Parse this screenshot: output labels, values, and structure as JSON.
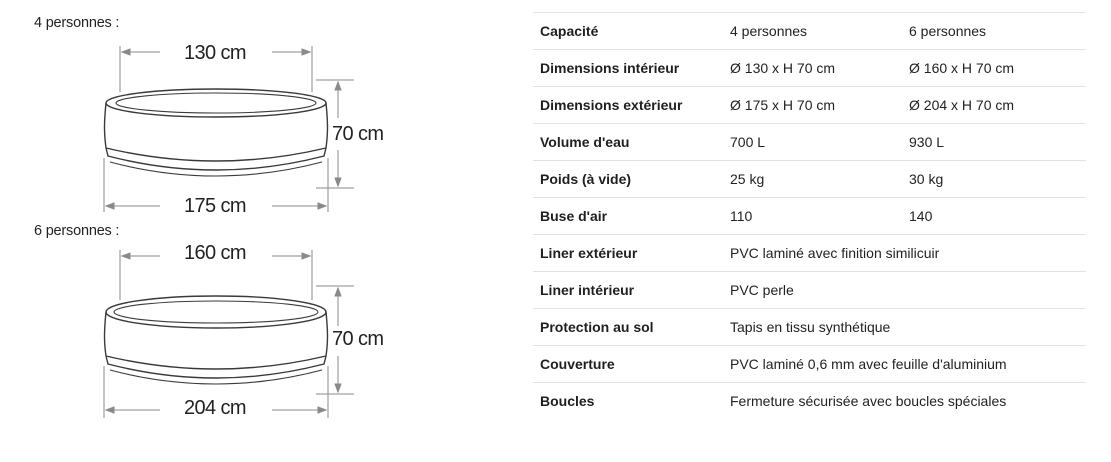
{
  "diagrams": [
    {
      "caption": "4 personnes :",
      "top_dim": "130 cm",
      "height_dim": "70 cm",
      "bottom_dim": "175 cm"
    },
    {
      "caption": "6 personnes :",
      "top_dim": "160 cm",
      "height_dim": "70 cm",
      "bottom_dim": "204 cm"
    }
  ],
  "specs": [
    {
      "label": "Capacité",
      "v1": "4 personnes",
      "v2": "6 personnes"
    },
    {
      "label": "Dimensions intérieur",
      "v1": "Ø 130 x H 70 cm",
      "v2": "Ø 160 x H 70 cm"
    },
    {
      "label": "Dimensions extérieur",
      "v1": "Ø 175 x H 70 cm",
      "v2": "Ø 204 x H 70 cm"
    },
    {
      "label": "Volume d'eau",
      "v1": "700 L",
      "v2": "930 L"
    },
    {
      "label": "Poids (à vide)",
      "v1": "25 kg",
      "v2": "30 kg"
    },
    {
      "label": "Buse d'air",
      "v1": "110",
      "v2": "140"
    },
    {
      "label": "Liner extérieur",
      "span": "PVC laminé avec finition similicuir"
    },
    {
      "label": "Liner intérieur",
      "span": "PVC perle"
    },
    {
      "label": "Protection au sol",
      "span": "Tapis en tissu synthétique"
    },
    {
      "label": "Couverture",
      "span": "PVC laminé 0,6 mm avec feuille d'aluminium"
    },
    {
      "label": "Boucles",
      "span": "Fermeture sécurisée avec boucles spéciales"
    }
  ]
}
